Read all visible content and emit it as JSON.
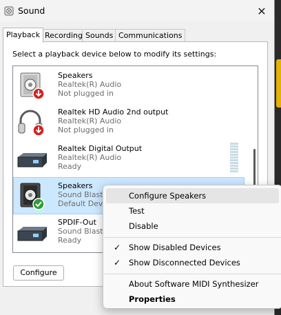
{
  "window": {
    "title": "Sound",
    "close_label": "✕"
  },
  "tabs": [
    {
      "label": "Playback"
    },
    {
      "label": "Recording"
    },
    {
      "label": "Sounds"
    },
    {
      "label": "Communications"
    }
  ],
  "instruction": "Select a playback device below to modify its settings:",
  "devices": [
    {
      "name": "Speakers",
      "sub": "Realtek(R) Audio",
      "status": "Not plugged in",
      "icon": "speaker-icon",
      "badge": "red-down-arrow"
    },
    {
      "name": "Realtek HD Audio 2nd output",
      "sub": "Realtek(R) Audio",
      "status": "Not plugged in",
      "icon": "headphones-icon",
      "badge": "red-down-arrow"
    },
    {
      "name": "Realtek Digital Output",
      "sub": "Realtek(R) Audio",
      "status": "Ready",
      "icon": "digital-output-icon"
    },
    {
      "name": "Speakers",
      "sub": "Sound Blaster",
      "status": "Default Device",
      "icon": "speaker-icon",
      "badge": "green-check",
      "selected": true
    },
    {
      "name": "SPDIF-Out",
      "sub": "Sound Blaster",
      "status": "Ready",
      "icon": "digital-output-icon"
    }
  ],
  "configure_label": "Configure",
  "context_menu": {
    "items": [
      {
        "label": "Configure Speakers",
        "highlighted": true
      },
      {
        "label": "Test"
      },
      {
        "label": "Disable"
      },
      {
        "label": "Show Disabled Devices",
        "checked": true
      },
      {
        "label": "Show Disconnected Devices",
        "checked": true
      },
      {
        "label": "About Software MIDI Synthesizer"
      },
      {
        "label": "Properties",
        "bold": true
      }
    ],
    "check_glyph": "✓"
  },
  "colors": {
    "selection_bg": "#cce8ff",
    "selection_border": "#99d1ff",
    "badge_red": "#d42222",
    "badge_green": "#2e9e36",
    "wallpaper_accent": "#e6b100"
  }
}
